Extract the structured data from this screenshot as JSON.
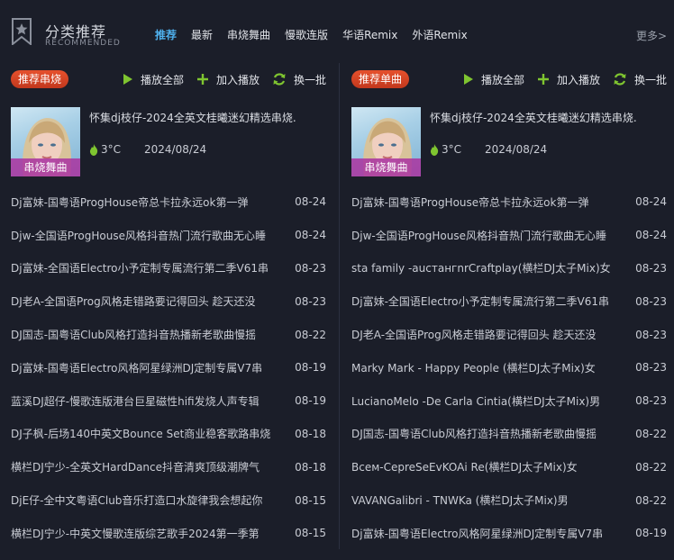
{
  "header": {
    "title": "分类推荐",
    "subtitle": "RECOMMENDED",
    "tabs": [
      {
        "label": "推荐",
        "active": true
      },
      {
        "label": "最新",
        "active": false
      },
      {
        "label": "串烧舞曲",
        "active": false
      },
      {
        "label": "慢歌连版",
        "active": false
      },
      {
        "label": "华语Remix",
        "active": false
      },
      {
        "label": "外语Remix",
        "active": false
      }
    ],
    "more": "更多>"
  },
  "colors": {
    "accent": "#4fb1ee",
    "badge": "#d8452a",
    "play_green": "#7fc530",
    "page_bg": "#1b1e29"
  },
  "left": {
    "badge": "推荐串烧",
    "actions": {
      "play_all": "播放全部",
      "add_play": "加入播放",
      "refresh": "换一批"
    },
    "feature": {
      "title": "怀集dj枝仔-2024全英文桂曦迷幻精选串烧.",
      "heat": "3°C",
      "date": "2024/08/24",
      "cover_label": "串烧舞曲"
    },
    "items": [
      {
        "name": "Dj富妹-国粤语ProgHouse帝总卡拉永远ok第一弹",
        "date": "08-24"
      },
      {
        "name": "Djw-全国语ProgHouse风格抖音热门流行歌曲无心睡",
        "date": "08-24"
      },
      {
        "name": "Dj富妹-全国语Electro小予定制专属流行第二季V61串",
        "date": "08-23"
      },
      {
        "name": "DJ老A-全国语Prog风格走错路要记得回头 趁天还没",
        "date": "08-23"
      },
      {
        "name": "DJ国志-国粤语Club风格打造抖音热播新老歌曲慢摇",
        "date": "08-22"
      },
      {
        "name": "Dj富妹-国粤语Electro风格阿星绿洲DJ定制专属V7串",
        "date": "08-19"
      },
      {
        "name": "蓝溪DJ超仔-慢歌连版港台巨星磁性hifi发烧人声专辑",
        "date": "08-19"
      },
      {
        "name": "DJ子枫-后场140中英文Bounce Set商业稳客歌路串烧",
        "date": "08-18"
      },
      {
        "name": "横栏DJ宁少-全英文HardDance抖音清爽顶级潮牌气",
        "date": "08-18"
      },
      {
        "name": "DjE仔-全中文粤语Club音乐打造口水旋律我会想起你",
        "date": "08-15"
      },
      {
        "name": "横栏DJ宁少-中英文慢歌连版综艺歌手2024第一季第",
        "date": "08-15"
      }
    ]
  },
  "right": {
    "badge": "推荐单曲",
    "actions": {
      "play_all": "播放全部",
      "add_play": "加入播放",
      "refresh": "换一批"
    },
    "feature": {
      "title": "怀集dj枝仔-2024全英文桂曦迷幻精选串烧.",
      "heat": "3°C",
      "date": "2024/08/24",
      "cover_label": "串烧舞曲"
    },
    "items": [
      {
        "name": "Dj富妹-国粤语ProgHouse帝总卡拉永远ok第一弹",
        "date": "08-24"
      },
      {
        "name": "Djw-全国语ProgHouse风格抖音热门流行歌曲无心睡",
        "date": "08-24"
      },
      {
        "name": "sta family -aucтaнгnrCraftplay(横栏DJ太子Mix)女",
        "date": "08-23"
      },
      {
        "name": "Dj富妹-全国语Electro小予定制专属流行第二季V61串",
        "date": "08-23"
      },
      {
        "name": "DJ老A-全国语Prog风格走错路要记得回头 趁天还没",
        "date": "08-23"
      },
      {
        "name": "Marky Mark - Happy People (横栏DJ太子Mix)女",
        "date": "08-23"
      },
      {
        "name": "LucianoMelo -De Carla Cintia(横栏DJ太子Mix)男",
        "date": "08-23"
      },
      {
        "name": "DJ国志-国粤语Club风格打造抖音热播新老歌曲慢摇",
        "date": "08-22"
      },
      {
        "name": "Bceм-CepreSeEvKOAi Re(横栏DJ太子Mix)女",
        "date": "08-22"
      },
      {
        "name": "VAVANGalibri - TNWKa (横栏DJ太子Mix)男",
        "date": "08-22"
      },
      {
        "name": "Dj富妹-国粤语Electro风格阿星绿洲DJ定制专属V7串",
        "date": "08-19"
      }
    ]
  }
}
